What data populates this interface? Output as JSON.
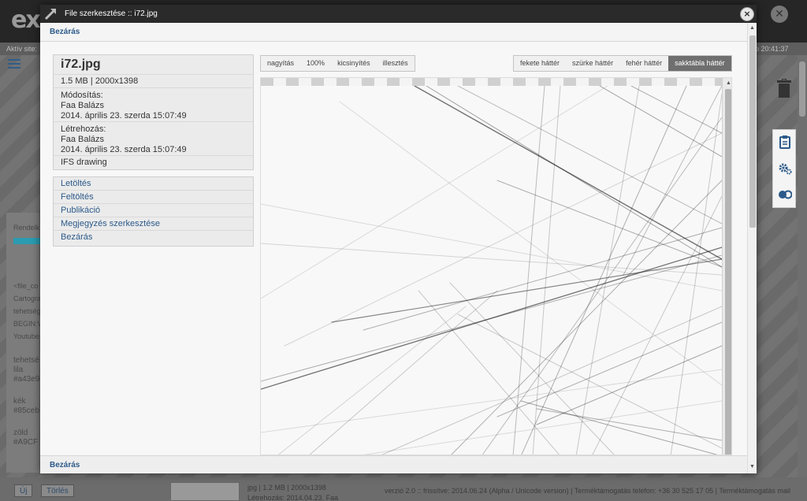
{
  "background_app": {
    "logo": "ex",
    "active_site_label": "Aktív site: ",
    "clock_text": "p 20:41:37",
    "left_labels": [
      "Rendelk",
      "<file_co",
      "Cartogra",
      "tehetség",
      "BEGIN:V",
      "Youtube"
    ],
    "colors_list": [
      "tehetsé",
      "lila",
      "#a43e9",
      "kék",
      "#85ceb",
      "zöld",
      "#A9CF"
    ],
    "bottom_buttons": [
      "Új",
      "Törlés"
    ],
    "thumb_info_1": "jpg | 1.2 MB | 2000x1398",
    "thumb_info_2": "Létrehozás: 2014.04.23. Faa",
    "footer_text": "verzió 2.0 :: frissítve: 2014.06.24 (Alpha / Unicode version) | Terméktámogatás telefon: +36 30 525 17 05 | Terméktámogatás mail"
  },
  "modal": {
    "title": "File szerkesztése :: i72.jpg",
    "close_label": "×",
    "top_close_link": "Bezárás",
    "bottom_close_link": "Bezárás"
  },
  "file_info": {
    "name": "i72.jpg",
    "size_dims": "1.5 MB | 2000x1398",
    "modified_label": "Módosítás:",
    "modified_by": "Faa Balázs",
    "modified_date": "2014. április 23. szerda 15:07:49",
    "created_label": "Létrehozás:",
    "created_by": "Faa Balázs",
    "created_date": "2014. április 23. szerda 15:07:49",
    "tag": "IFS drawing"
  },
  "actions": [
    "Letöltés",
    "Feltöltés",
    "Publikáció",
    "Megjegyzés szerkesztése",
    "Bezárás"
  ],
  "zoom_toolbar": [
    "nagyítás",
    "100%",
    "kicsinyítés",
    "illesztés"
  ],
  "background_toolbar": {
    "options": [
      "fekete háttér",
      "szürke háttér",
      "fehér háttér",
      "sakktábla háttér"
    ],
    "selected": "sakktábla háttér"
  },
  "icons": {
    "logo": "expand-arrow-icon",
    "tool_1": "clipboard-icon",
    "tool_2": "gears-icon",
    "tool_3": "toggle-circles-icon",
    "trash": "trash-icon"
  },
  "colors": {
    "accent_link": "#2c5a8a",
    "titlebar": "#2a2a2a",
    "active_button": "#6f6f6f",
    "progress_teal": "#2a9bb0"
  }
}
